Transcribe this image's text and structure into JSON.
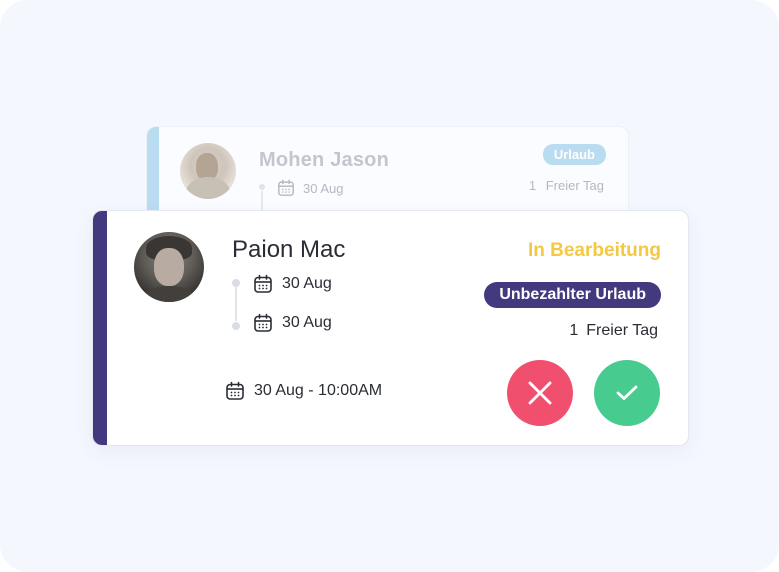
{
  "back_card": {
    "name": "Mohen Jason",
    "date": "30 Aug",
    "badge": "Urlaub",
    "days_count": "1",
    "days_label": "Freier Tag"
  },
  "card": {
    "name": "Paion Mac",
    "status": "In Bearbeitung",
    "badge": "Unbezahlter Urlaub",
    "days_count": "1",
    "days_label": "Freier Tag",
    "start_date": "30 Aug",
    "end_date": "30 Aug",
    "request_datetime": "30 Aug - 10:00AM"
  },
  "colors": {
    "accent": "#43397e",
    "status": "#f5c842",
    "reject": "#f0506e",
    "approve": "#47cb8f",
    "back_accent": "#b9dcf1"
  },
  "icons": {
    "calendar": "calendar-icon",
    "reject": "close-icon",
    "approve": "check-icon"
  }
}
